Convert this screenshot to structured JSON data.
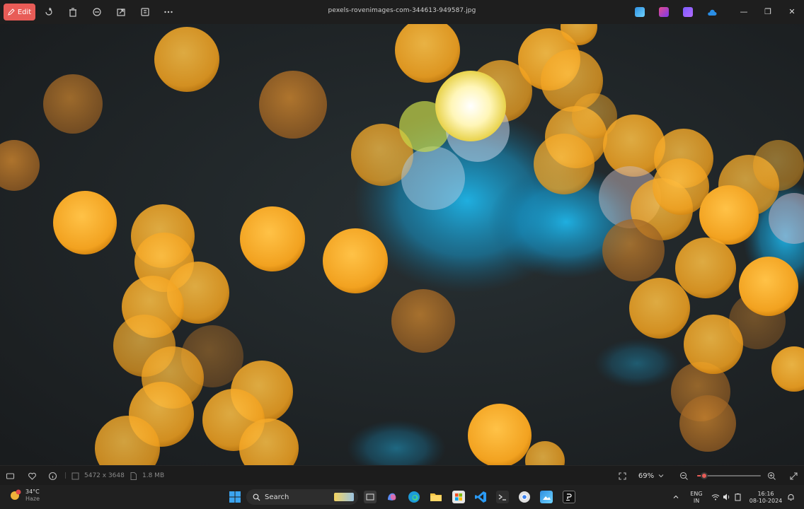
{
  "titlebar": {
    "edit_label": "Edit",
    "filename": "pexels-rovenimages-com-344613-949587.jpg",
    "min_glyph": "—",
    "max_glyph": "❐",
    "close_glyph": "✕"
  },
  "status": {
    "dimensions": "5472 x 3648",
    "filesize": "1.8 MB",
    "zoom": "69%"
  },
  "taskbar": {
    "weather_temp": "34°C",
    "weather_desc": "Haze",
    "search_placeholder": "Search",
    "lang_top": "ENG",
    "lang_bottom": "IN",
    "time": "16:16",
    "date": "08-10-2024"
  },
  "colors": {
    "accent": "#e85c57",
    "bokeh_orange": "#f5a623",
    "bokeh_blue": "#1aa6d6"
  }
}
